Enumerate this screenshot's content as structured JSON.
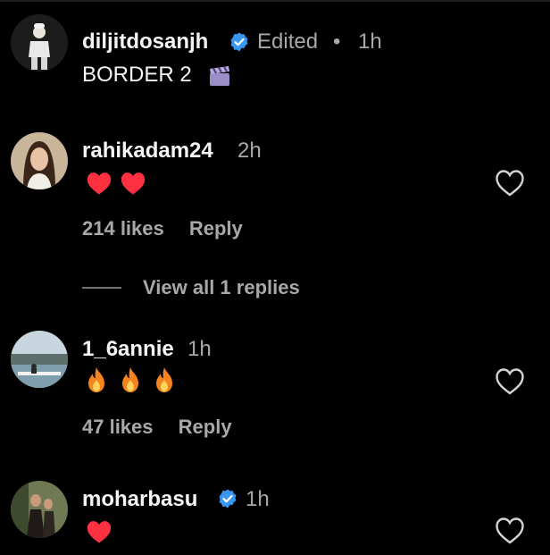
{
  "post": {
    "username": "diljitdosanjh",
    "edited_label": "Edited",
    "dot": "•",
    "time": "1h",
    "caption": "BORDER 2",
    "caption_icon": "clapper-board-icon"
  },
  "comments": [
    {
      "username": "rahikadam24",
      "time": "2h",
      "emojis": [
        "red-heart-icon",
        "red-heart-icon"
      ],
      "likes_label": "214 likes",
      "reply_label": "Reply"
    },
    {
      "username": "1_6annie",
      "time": "1h",
      "emojis": [
        "fire-icon",
        "fire-icon",
        "fire-icon"
      ],
      "likes_label": "47 likes",
      "reply_label": "Reply"
    },
    {
      "username": "moharbasu",
      "time": "1h",
      "emojis": [
        "red-heart-icon"
      ]
    }
  ],
  "view_replies_label": "View all 1 replies",
  "colors": {
    "background": "#000000",
    "text_primary": "#f5f5f5",
    "text_secondary": "#a8a8a8",
    "verified_blue": "#3897f0",
    "heart_red": "#ff3040"
  }
}
